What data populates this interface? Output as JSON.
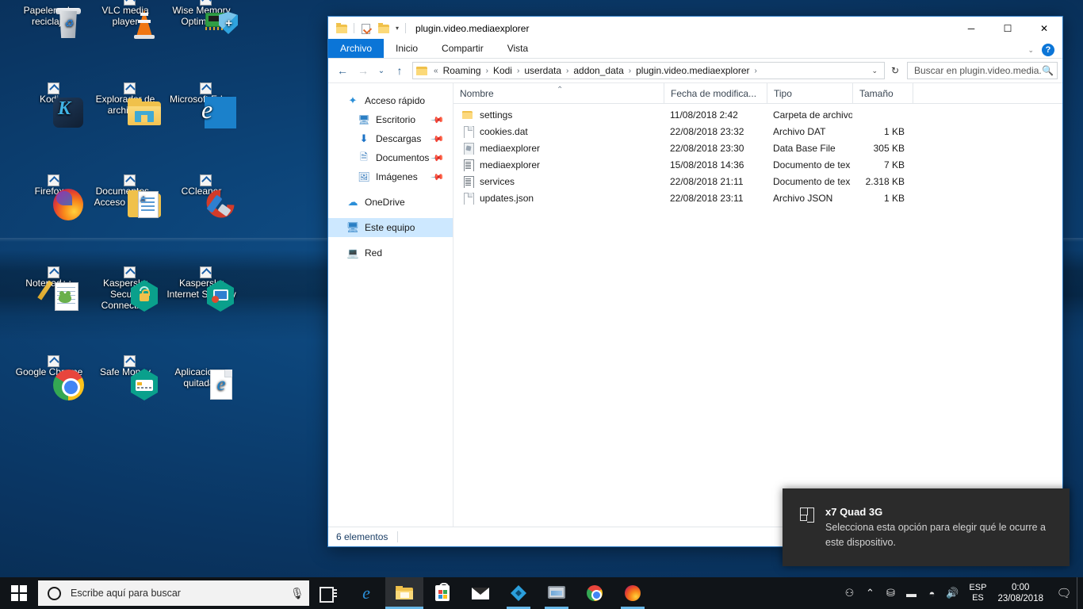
{
  "desktop": {
    "icons": [
      {
        "label": "Papelera de reciclaje",
        "icon": "recycle-bin-icon",
        "shortcut": false,
        "art": "recyclebin"
      },
      {
        "label": "VLC media player",
        "icon": "vlc-icon",
        "shortcut": true,
        "art": "vlc"
      },
      {
        "label": "Wise Memory Optimizer",
        "icon": "wise-memory-optimizer-icon",
        "shortcut": true,
        "art": "wise"
      },
      {
        "label": "Kodi",
        "icon": "kodi-icon",
        "shortcut": true,
        "art": "kodi"
      },
      {
        "label": "Explorador de archivos",
        "icon": "file-explorer-icon",
        "shortcut": true,
        "art": "folder"
      },
      {
        "label": "Microsoft Edge",
        "icon": "microsoft-edge-icon",
        "shortcut": true,
        "art": "edge"
      },
      {
        "label": "Firefox",
        "icon": "firefox-icon",
        "shortcut": true,
        "art": "firefox"
      },
      {
        "label": "Documentos - Acceso directo",
        "icon": "documents-shortcut-icon",
        "shortcut": true,
        "art": "docfolder"
      },
      {
        "label": "CCleaner",
        "icon": "ccleaner-icon",
        "shortcut": true,
        "art": "ccleaner"
      },
      {
        "label": "Notepad++",
        "icon": "notepad-plus-plus-icon",
        "shortcut": true,
        "art": "notepad"
      },
      {
        "label": "Kaspersky Secure Connection",
        "icon": "kaspersky-secure-connection-icon",
        "shortcut": true,
        "art": "ksc"
      },
      {
        "label": "Kaspersky Internet Security",
        "icon": "kaspersky-internet-security-icon",
        "shortcut": true,
        "art": "kis"
      },
      {
        "label": "Google Chrome",
        "icon": "google-chrome-icon",
        "shortcut": true,
        "art": "chrome"
      },
      {
        "label": "Safe Money",
        "icon": "safe-money-icon",
        "shortcut": true,
        "art": "safemoney"
      },
      {
        "label": "Aplicaciones quitadas",
        "icon": "removed-apps-icon",
        "shortcut": false,
        "art": "edgedoc"
      }
    ]
  },
  "explorer": {
    "title": "plugin.video.mediaexplorer",
    "quick_access_toolbar": [
      {
        "name": "folder-icon"
      },
      {
        "name": "properties-icon"
      },
      {
        "name": "new-folder-icon"
      },
      {
        "name": "customize-caret-icon",
        "glyph": "▾"
      }
    ],
    "window_buttons": {
      "minimize": "─",
      "maximize": "☐",
      "close": "✕"
    },
    "ribbon": {
      "tabs": [
        {
          "label": "Archivo",
          "active": true
        },
        {
          "label": "Inicio",
          "active": false
        },
        {
          "label": "Compartir",
          "active": false
        },
        {
          "label": "Vista",
          "active": false
        }
      ],
      "collapse_glyph": "⌄",
      "help_glyph": "?"
    },
    "navigation": {
      "back_glyph": "←",
      "forward_glyph": "→",
      "recent_glyph": "⌄",
      "up_glyph": "↑",
      "breadcrumb_prefix": "«",
      "breadcrumbs": [
        "Roaming",
        "Kodi",
        "userdata",
        "addon_data",
        "plugin.video.mediaexplorer"
      ],
      "separator": "›",
      "dropdown_glyph": "⌄",
      "refresh_glyph": "↻"
    },
    "search": {
      "placeholder": "Buscar en plugin.video.media...",
      "value": "",
      "icon": "search-icon"
    },
    "sidebar": [
      {
        "label": "Acceso rápido",
        "icon": "quick-access-star-icon",
        "indent": false,
        "pinned": false,
        "selected": false
      },
      {
        "label": "Escritorio",
        "icon": "desktop-icon",
        "indent": true,
        "pinned": true,
        "selected": false
      },
      {
        "label": "Descargas",
        "icon": "downloads-icon",
        "indent": true,
        "pinned": true,
        "selected": false
      },
      {
        "label": "Documentos",
        "icon": "documents-icon",
        "indent": true,
        "pinned": true,
        "selected": false
      },
      {
        "label": "Imágenes",
        "icon": "pictures-icon",
        "indent": true,
        "pinned": true,
        "selected": false
      },
      {
        "label": "OneDrive",
        "icon": "onedrive-cloud-icon",
        "indent": false,
        "pinned": false,
        "selected": false,
        "gap_before": true
      },
      {
        "label": "Este equipo",
        "icon": "this-pc-icon",
        "indent": false,
        "pinned": false,
        "selected": true,
        "gap_before": true
      },
      {
        "label": "Red",
        "icon": "network-icon",
        "indent": false,
        "pinned": false,
        "selected": false,
        "gap_before": true
      }
    ],
    "columns": [
      {
        "label": "Nombre",
        "sorted": true,
        "sort_glyph": "⌃"
      },
      {
        "label": "Fecha de modifica...",
        "sorted": false
      },
      {
        "label": "Tipo",
        "sorted": false
      },
      {
        "label": "Tamaño",
        "sorted": false
      }
    ],
    "files": [
      {
        "name": "settings",
        "date": "11/08/2018 2:42",
        "type": "Carpeta de archivos",
        "size": "",
        "icon": "folder-icon"
      },
      {
        "name": "cookies.dat",
        "date": "22/08/2018 23:32",
        "type": "Archivo DAT",
        "size": "1 KB",
        "icon": "dat-file-icon"
      },
      {
        "name": "mediaexplorer",
        "date": "22/08/2018 23:30",
        "type": "Data Base File",
        "size": "305 KB",
        "icon": "database-file-icon"
      },
      {
        "name": "mediaexplorer",
        "date": "15/08/2018 14:36",
        "type": "Documento de tex",
        "size": "7 KB",
        "icon": "text-file-icon"
      },
      {
        "name": "services",
        "date": "22/08/2018 21:11",
        "type": "Documento de tex",
        "size": "2.318 KB",
        "icon": "text-file-icon"
      },
      {
        "name": "updates.json",
        "date": "22/08/2018 23:11",
        "type": "Archivo JSON",
        "size": "1 KB",
        "icon": "json-file-icon"
      }
    ],
    "status": "6 elementos"
  },
  "toast": {
    "icon": "device-layout-icon",
    "title": "x7 Quad 3G",
    "message": "Selecciona esta opción para elegir qué le ocurre a este dispositivo."
  },
  "taskbar": {
    "start_icon": "windows-start-icon",
    "search": {
      "placeholder": "Escribe aquí para buscar",
      "cortana_icon": "cortana-icon",
      "mic_icon": "microphone-icon",
      "mic_glyph": "🎙"
    },
    "apps": [
      {
        "name": "task-view-button",
        "art": "taskview",
        "state": ""
      },
      {
        "name": "taskbar-edge",
        "art": "edge",
        "state": ""
      },
      {
        "name": "taskbar-file-explorer",
        "art": "folder",
        "state": "active"
      },
      {
        "name": "taskbar-microsoft-store",
        "art": "store",
        "state": ""
      },
      {
        "name": "taskbar-mail",
        "art": "mail",
        "state": ""
      },
      {
        "name": "taskbar-kodi",
        "art": "kodi",
        "state": "running"
      },
      {
        "name": "taskbar-system-monitor",
        "art": "monitor",
        "state": "running"
      },
      {
        "name": "taskbar-google-chrome",
        "art": "chrome",
        "state": ""
      },
      {
        "name": "taskbar-firefox",
        "art": "firefox",
        "state": "running"
      }
    ],
    "tray": {
      "icons": [
        {
          "name": "people-icon",
          "glyph": "⚇"
        },
        {
          "name": "show-hidden-icons-chevron",
          "glyph": "⌃"
        },
        {
          "name": "usb-safely-remove-icon",
          "glyph": "⛁"
        },
        {
          "name": "battery-icon",
          "glyph": "▬"
        },
        {
          "name": "wifi-icon",
          "glyph": "📶"
        },
        {
          "name": "volume-icon",
          "glyph": "🔊"
        }
      ],
      "language_line1": "ESP",
      "language_line2": "ES",
      "time": "0:00",
      "date": "23/08/2018",
      "action_center_icon": "action-center-icon",
      "action_center_glyph": "🗩"
    }
  }
}
